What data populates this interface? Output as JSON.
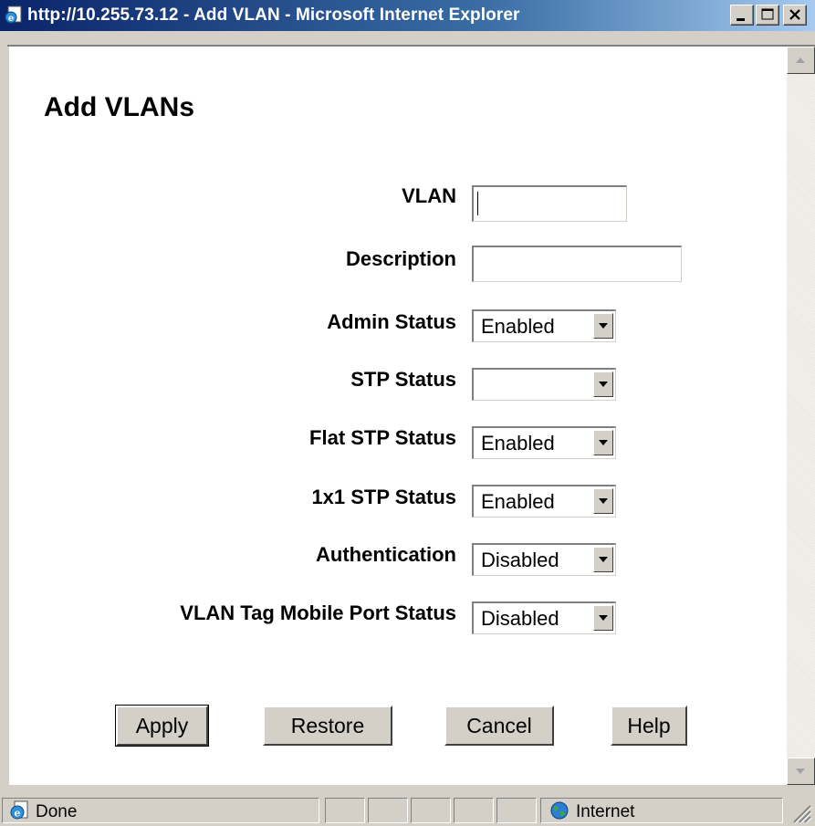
{
  "window": {
    "title": "http://10.255.73.12 - Add VLAN - Microsoft Internet Explorer"
  },
  "page": {
    "title": "Add VLANs"
  },
  "form": {
    "vlan": {
      "label": "VLAN",
      "value": ""
    },
    "description": {
      "label": "Description",
      "value": ""
    },
    "admin_status": {
      "label": "Admin Status",
      "value": "Enabled"
    },
    "stp_status": {
      "label": "STP Status",
      "value": ""
    },
    "flat_stp_status": {
      "label": "Flat STP Status",
      "value": "Enabled"
    },
    "one_x_one_stp_status": {
      "label": "1x1 STP Status",
      "value": "Enabled"
    },
    "authentication": {
      "label": "Authentication",
      "value": "Disabled"
    },
    "vlan_tag_mobile_port_status": {
      "label": "VLAN Tag Mobile Port Status",
      "value": "Disabled"
    }
  },
  "buttons": {
    "apply": "Apply",
    "restore": "Restore",
    "cancel": "Cancel",
    "help": "Help"
  },
  "statusbar": {
    "status": "Done",
    "zone": "Internet"
  }
}
